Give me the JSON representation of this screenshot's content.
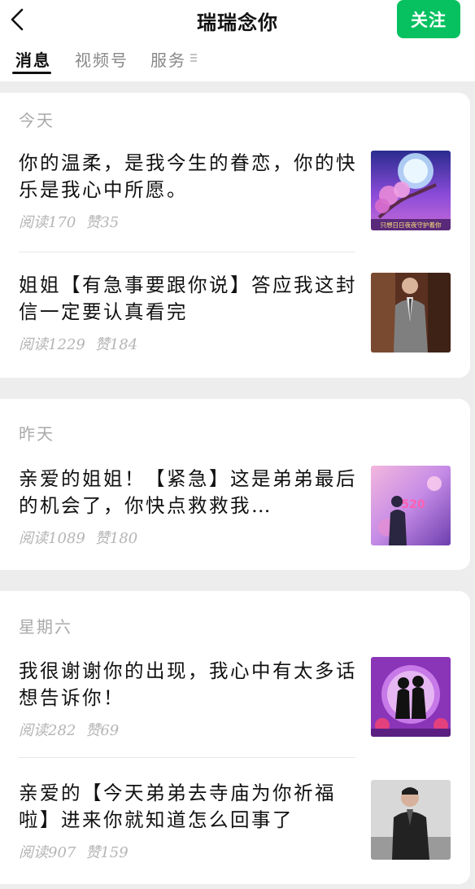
{
  "header": {
    "title": "瑞瑞念你",
    "follow_label": "关注"
  },
  "tabs": [
    {
      "label": "消息",
      "active": true
    },
    {
      "label": "视频号",
      "active": false
    },
    {
      "label": "服务",
      "active": false
    }
  ],
  "groups": [
    {
      "day": "今天",
      "articles": [
        {
          "title": "你的温柔，是我今生的眷恋，你的快乐是我心中所愿。",
          "reads": "阅读170",
          "likes": "赞35",
          "thumb_caption": "只想日日夜夜守护着你"
        },
        {
          "title": "姐姐【有急事要跟你说】答应我这封信一定要认真看完",
          "reads": "阅读1229",
          "likes": "赞184"
        }
      ]
    },
    {
      "day": "昨天",
      "articles": [
        {
          "title": "亲爱的姐姐！【紧急】这是弟弟最后的机会了，你快点救救我…",
          "reads": "阅读1089",
          "likes": "赞180",
          "thumb_caption": "520"
        }
      ]
    },
    {
      "day": "星期六",
      "articles": [
        {
          "title": "我很谢谢你的出现，我心中有太多话想告诉你！",
          "reads": "阅读282",
          "likes": "赞69"
        },
        {
          "title": "亲爱的【今天弟弟去寺庙为你祈福啦】进来你就知道怎么回事了",
          "reads": "阅读907",
          "likes": "赞159"
        }
      ]
    }
  ],
  "colors": {
    "accent": "#07c160",
    "background": "#ededed",
    "meta_text": "#b5b5b5"
  }
}
